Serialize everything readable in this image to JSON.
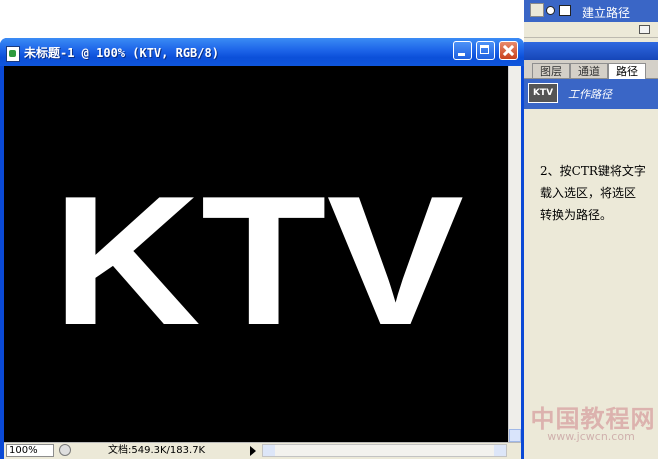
{
  "document_window": {
    "title": "未标题-1 @ 100% (KTV, RGB/8)",
    "canvas_text": "KTV",
    "canvas_background": "#000000",
    "canvas_text_color": "#ffffff"
  },
  "status_bar": {
    "zoom": "100%",
    "doc_size": "文档:549.3K/183.7K"
  },
  "history_panel": {
    "active_step_label": "建立路径"
  },
  "paths_panel": {
    "tabs": [
      {
        "label": "图层"
      },
      {
        "label": "通道"
      },
      {
        "label": "路径",
        "active": true
      }
    ],
    "path_item": {
      "thumb_text": "KTV",
      "name": "工作路径"
    }
  },
  "instructions": {
    "line1": "2、按CTR键将文字",
    "line2": "载入选区，将选区",
    "line3": "转换为路径。"
  },
  "watermark": {
    "site_name": "中国教程网",
    "url": "www.jcwcn.com"
  },
  "colors": {
    "title_bar_blue": "#1c63e8",
    "selection_blue": "#3a66c6",
    "panel_bg": "#ece9d8"
  }
}
